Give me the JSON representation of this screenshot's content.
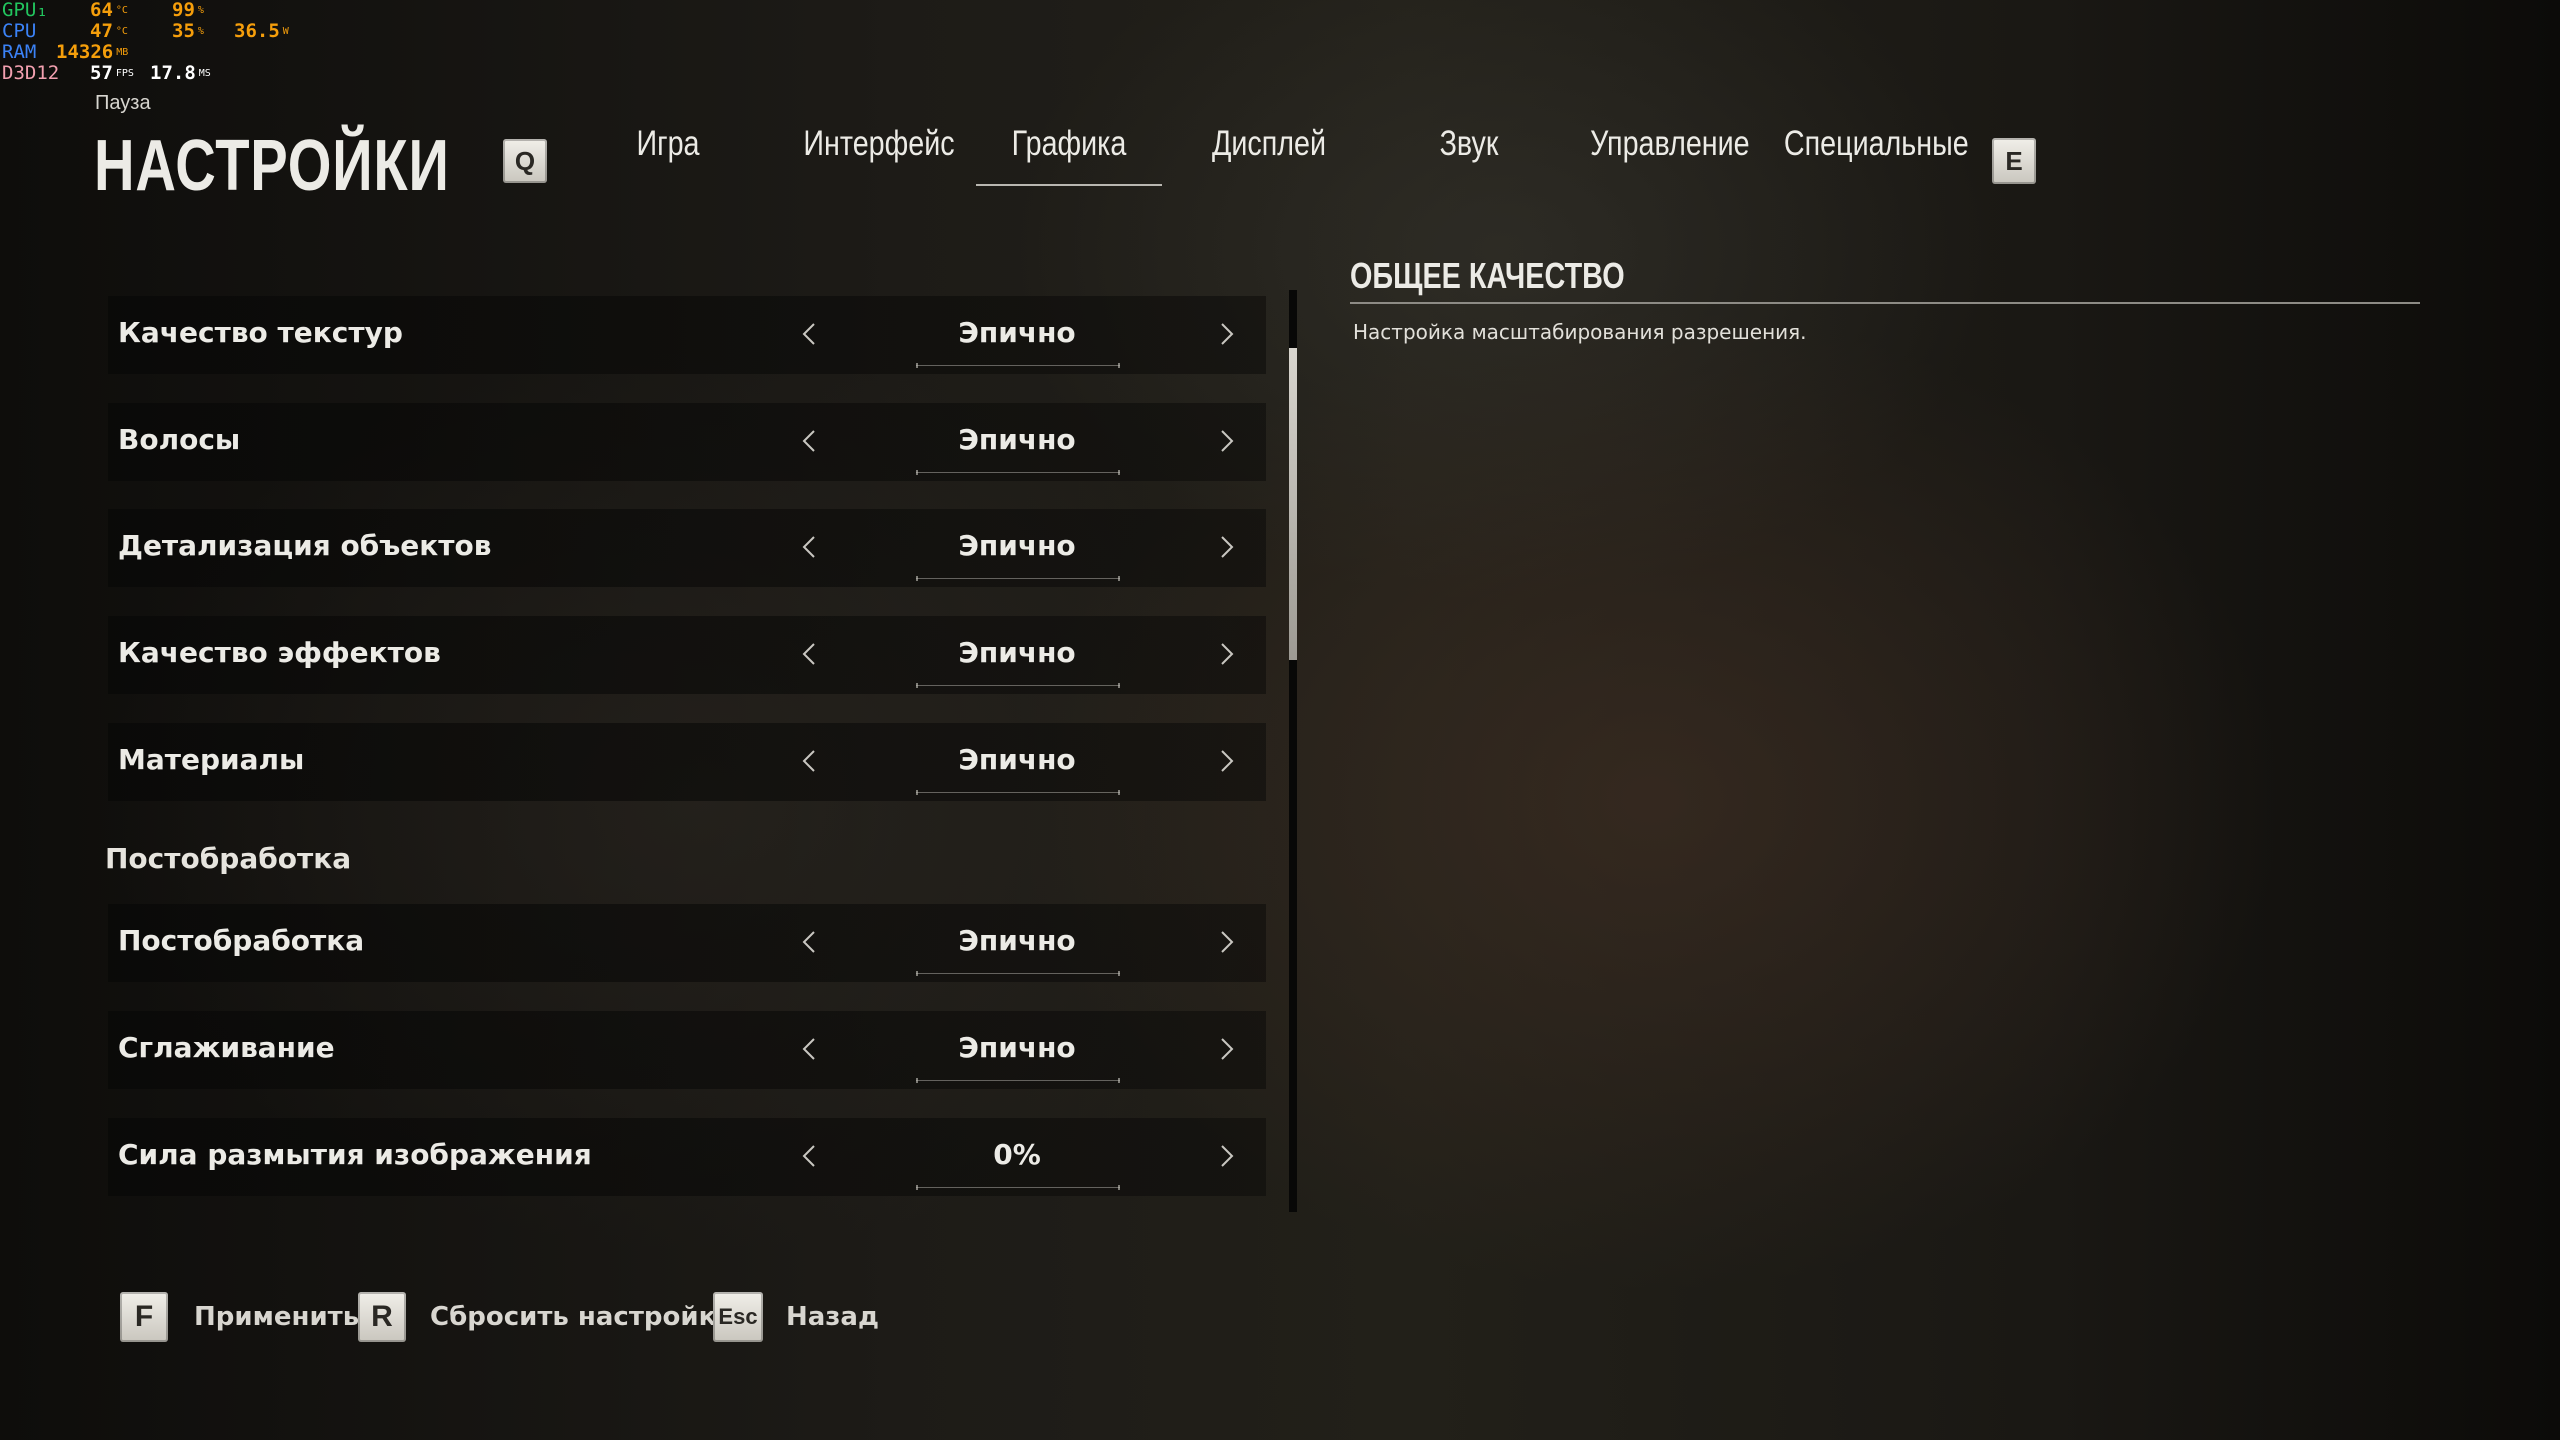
{
  "overlay": {
    "rows": [
      {
        "label": "GPU₁",
        "label_color": "#22c55e",
        "v1": "64",
        "u1": "°C",
        "v1_color": "#f59e0b",
        "v2": "99",
        "u2": "%",
        "v2_color": "#f59e0b",
        "v3": "",
        "u3": "",
        "v3_color": "#f59e0b"
      },
      {
        "label": "CPU",
        "label_color": "#3b82f6",
        "v1": "47",
        "u1": "°C",
        "v1_color": "#f59e0b",
        "v2": "35",
        "u2": "%",
        "v2_color": "#f59e0b",
        "v3": "36.5",
        "u3": "W",
        "v3_color": "#f59e0b"
      },
      {
        "label": "RAM",
        "label_color": "#3b82f6",
        "v1": "14326",
        "u1": "MB",
        "v1_color": "#f59e0b",
        "v2": "",
        "u2": "",
        "v2_color": "#f59e0b",
        "v3": "",
        "u3": "",
        "v3_color": "#f59e0b"
      },
      {
        "label": "D3D12",
        "label_color": "#f2a0b0",
        "v1": "57",
        "u1": "FPS",
        "v1_color": "#ffffff",
        "v2": "17.8",
        "u2": "MS",
        "v2_color": "#ffffff",
        "v3": "",
        "u3": "",
        "v3_color": "#ffffff"
      }
    ]
  },
  "header": {
    "breadcrumb": "Пауза",
    "title": "НАСТРОЙКИ",
    "prev_key": "Q",
    "next_key": "E",
    "tabs": [
      {
        "label": "Игра"
      },
      {
        "label": "Интерфейс"
      },
      {
        "label": "Графика",
        "active": true
      },
      {
        "label": "Дисплей"
      },
      {
        "label": "Звук"
      },
      {
        "label": "Управление"
      },
      {
        "label": "Специальные"
      }
    ]
  },
  "settings": {
    "rows": [
      {
        "label": "Качество текстур",
        "value": "Эпично"
      },
      {
        "label": "Волосы",
        "value": "Эпично"
      },
      {
        "label": "Детализация объектов",
        "value": "Эпично"
      },
      {
        "label": "Качество эффектов",
        "value": "Эпично"
      },
      {
        "label": "Материалы",
        "value": "Эпично"
      },
      {
        "label": "Постобработка",
        "value": "Эпично"
      },
      {
        "label": "Сглаживание",
        "value": "Эпично"
      },
      {
        "label": "Сила размытия изображения",
        "value": "0%"
      }
    ],
    "section_postprocessing": "Постобработка"
  },
  "description": {
    "title": "ОБЩЕЕ КАЧЕСТВО",
    "text": "Настройка масштабирования разрешения."
  },
  "footer": {
    "apply_key": "F",
    "apply_label": "Применить",
    "reset_key": "R",
    "reset_label": "Сбросить настройки",
    "back_key": "Esc",
    "back_label": "Назад"
  }
}
